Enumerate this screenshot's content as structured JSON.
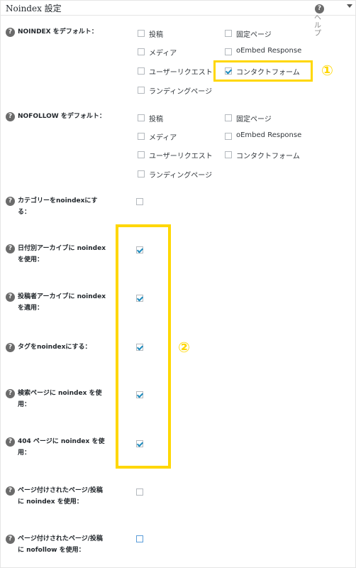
{
  "header": {
    "title": "Noindex 設定",
    "help_label": "ヘルプ"
  },
  "settings": {
    "noindex_default": {
      "label": "NOINDEX をデフォルト：",
      "options": [
        "投稿",
        "固定ページ",
        "メディア",
        "oEmbed Response",
        "ユーザーリクエスト",
        "コンタクトフォーム",
        "ランディングページ"
      ],
      "checked": [
        false,
        false,
        false,
        false,
        false,
        true,
        false
      ]
    },
    "nofollow_default": {
      "label": "NOFOLLOW をデフォルト：",
      "options": [
        "投稿",
        "固定ページ",
        "メディア",
        "oEmbed Response",
        "ユーザーリクエスト",
        "コンタクトフォーム",
        "ランディングページ"
      ],
      "checked": [
        false,
        false,
        false,
        false,
        false,
        false,
        false
      ]
    },
    "category_noindex": {
      "label_line1": "カテゴリーをnoindexにす",
      "label_line2": "る：",
      "checked": false
    },
    "date_archive": {
      "label_line1": "日付別アーカイブに noindex",
      "label_line2": "を使用：",
      "checked": true
    },
    "author_archive": {
      "label_line1": "投稿者アーカイブに noindex",
      "label_line2": "を適用：",
      "checked": true
    },
    "tag_noindex": {
      "label_line1": "タグをnoindexにする：",
      "checked": true
    },
    "search_page": {
      "label_line1": "検索ページに noindex を使",
      "label_line2": "用：",
      "checked": true
    },
    "page_404": {
      "label_line1": "404 ページに noindex を使",
      "label_line2": "用：",
      "checked": true
    },
    "paginated_noindex": {
      "label_line1": "ページ付けされたページ/投稿",
      "label_line2": "に noindex を使用：",
      "checked": false
    },
    "paginated_nofollow": {
      "label_line1": "ページ付けされたページ/投稿",
      "label_line2": "に nofollow を使用：",
      "checked": false
    }
  },
  "annotations": {
    "marker1": "①",
    "marker2": "②",
    "highlight_color": "#ffd700"
  }
}
